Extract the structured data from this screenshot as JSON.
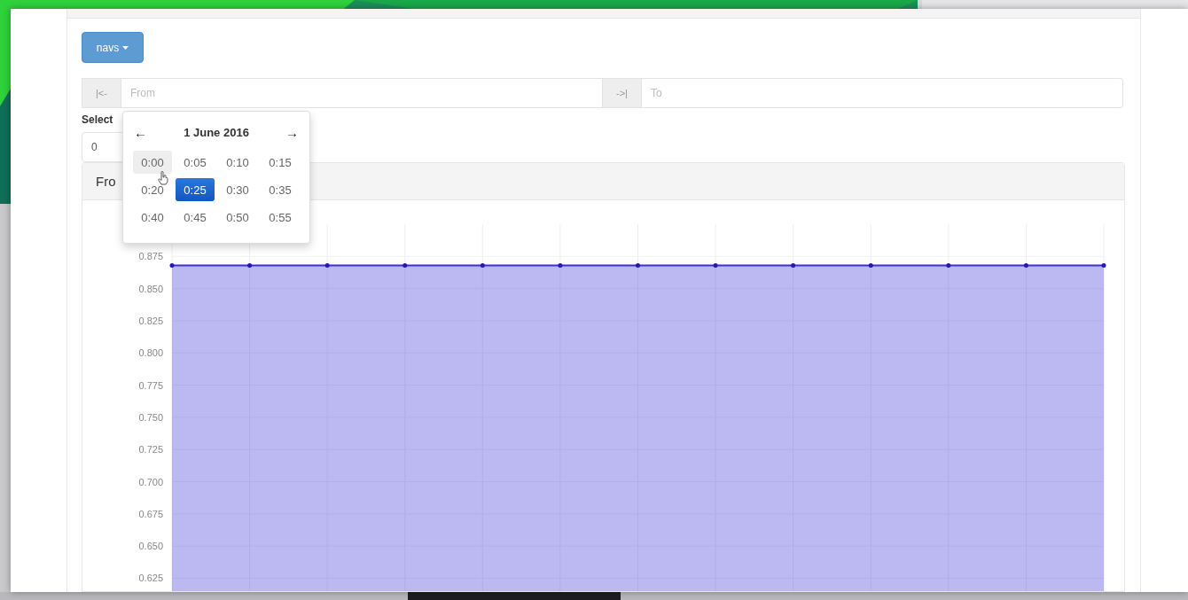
{
  "toolbar": {
    "dropdown_button": "navs"
  },
  "range": {
    "start_addon": "|<-",
    "from": {
      "placeholder": "From"
    },
    "end_addon": "->|",
    "to": {
      "placeholder": "To"
    }
  },
  "select": {
    "label": "Select",
    "value": "0"
  },
  "chart_panel": {
    "header": "Fro",
    "chart_data": {
      "type": "area",
      "grid": true,
      "series": [
        {
          "color": "#3a2fd8",
          "values": [
            0.868,
            0.868,
            0.868,
            0.868,
            0.868,
            0.868,
            0.868,
            0.868,
            0.868,
            0.868,
            0.868,
            0.868,
            0.868
          ]
        }
      ],
      "ylim": [
        0.615,
        0.9
      ],
      "yticks": [
        {
          "value": 0.875,
          "label": "0.875"
        },
        {
          "value": 0.85,
          "label": "0.850"
        },
        {
          "value": 0.825,
          "label": "0.825"
        },
        {
          "value": 0.8,
          "label": "0.800"
        },
        {
          "value": 0.775,
          "label": "0.775"
        },
        {
          "value": 0.75,
          "label": "0.750"
        },
        {
          "value": 0.725,
          "label": "0.725"
        },
        {
          "value": 0.7,
          "label": "0.700"
        },
        {
          "value": 0.675,
          "label": "0.675"
        },
        {
          "value": 0.65,
          "label": "0.650"
        },
        {
          "value": 0.625,
          "label": "0.625"
        }
      ]
    }
  },
  "time_picker": {
    "prev": "←",
    "title": "1 June 2016",
    "next": "→",
    "times": [
      {
        "label": "0:00",
        "selected": false,
        "hovered": true
      },
      {
        "label": "0:05",
        "selected": false,
        "hovered": false
      },
      {
        "label": "0:10",
        "selected": false,
        "hovered": false
      },
      {
        "label": "0:15",
        "selected": false,
        "hovered": false
      },
      {
        "label": "0:20",
        "selected": false,
        "hovered": false
      },
      {
        "label": "0:25",
        "selected": true,
        "hovered": false
      },
      {
        "label": "0:30",
        "selected": false,
        "hovered": false
      },
      {
        "label": "0:35",
        "selected": false,
        "hovered": false
      },
      {
        "label": "0:40",
        "selected": false,
        "hovered": false
      },
      {
        "label": "0:45",
        "selected": false,
        "hovered": false
      },
      {
        "label": "0:50",
        "selected": false,
        "hovered": false
      },
      {
        "label": "0:55",
        "selected": false,
        "hovered": false
      }
    ]
  }
}
